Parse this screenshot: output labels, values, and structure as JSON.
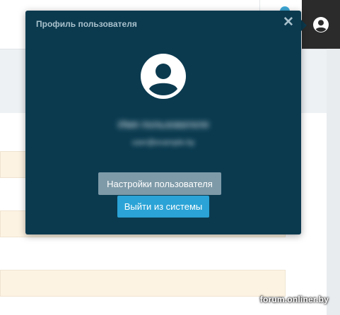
{
  "popup": {
    "title": "Профиль пользователя",
    "close_icon": "close-icon",
    "avatar_icon": "user-avatar-icon",
    "user_name": "Имя пользователя",
    "user_email": "user@example.by",
    "settings_label": "Настройки пользователя",
    "logout_label": "Выйти из системы"
  },
  "header": {
    "user_menu_icon": "user-circle-icon",
    "notification_icon": "notification-dot"
  },
  "watermark": "forum.onliner.by",
  "colors": {
    "popup_bg": "#0b3a4f",
    "settings_button": "#7e9aa8",
    "logout_button": "#2ba3d6",
    "highlight_row": "#fdf3e3"
  }
}
